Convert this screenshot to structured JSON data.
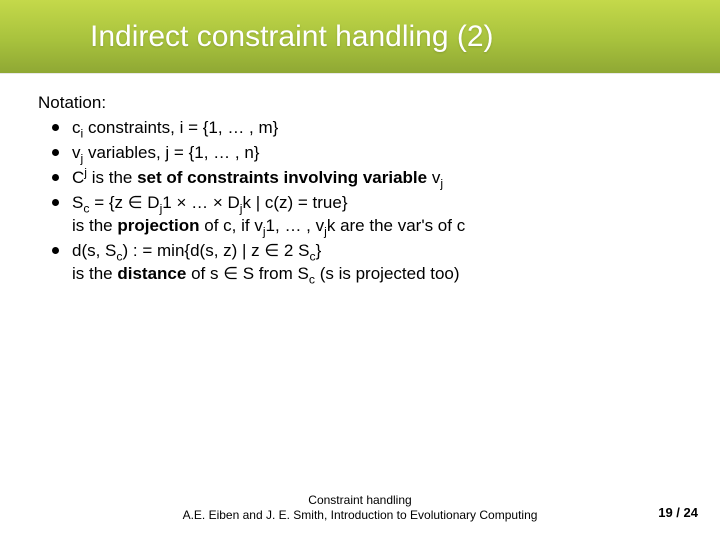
{
  "title": "Indirect constraint handling (2)",
  "heading": "Notation:",
  "items": [
    {
      "pre": "c",
      "sub1": "i",
      "mid": " constraints, i = {1, … , m}",
      "bold": "",
      "post": ""
    },
    {
      "pre": "v",
      "sub1": "j",
      "mid": " variables, j = {1, … , n}",
      "bold": "",
      "post": ""
    },
    {
      "pre": "C",
      "sup1": "j",
      "mid": " is the ",
      "bold": "set of constraints involving variable",
      "post_pre": " v",
      "post_sub": "j",
      "post_tail": ""
    },
    {
      "line1_pre": "S",
      "line1_sub": "c",
      "line1_mid": " = {z ∈ D",
      "line1_sub2": "j",
      "line1_mid2": "1 × … × D",
      "line1_sub3": "j",
      "line1_mid3": "k | c(z) = true}",
      "line2_pre": "is the ",
      "line2_bold": "projection",
      "line2_mid": " of c, if v",
      "line2_sub": "j",
      "line2_mid2": "1, … , v",
      "line2_sub2": "j",
      "line2_mid3": "k are the var's of c"
    },
    {
      "line1_pre": "d(s, S",
      "line1_sub": "c",
      "line1_mid": ") : = min{d(s, z) | z ∈ 2 S",
      "line1_sub2": "c",
      "line1_tail": "}",
      "line2_pre": "is the ",
      "line2_bold": "distance",
      "line2_mid": " of s ∈ S from S",
      "line2_sub": "c",
      "line2_tail": " (s is projected too)"
    }
  ],
  "footer": {
    "line1": "Constraint handling",
    "line2": "A.E. Eiben and J. E. Smith, Introduction to Evolutionary Computing"
  },
  "page": {
    "current": "19",
    "sep": " / ",
    "total": "24"
  }
}
